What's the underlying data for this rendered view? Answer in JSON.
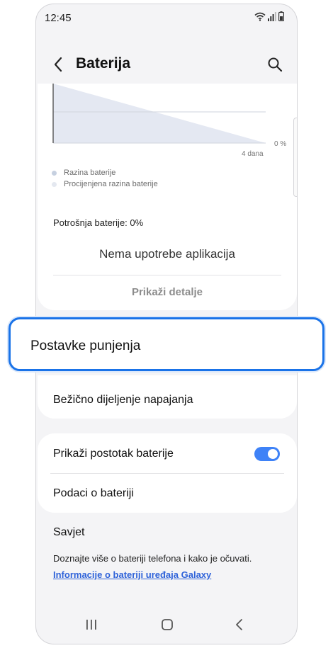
{
  "status_bar": {
    "time": "12:45",
    "icons": [
      "wifi-icon",
      "signal-icon",
      "battery-icon"
    ]
  },
  "header": {
    "title": "Baterija",
    "back_icon": "chevron-left-icon",
    "search_icon": "search-icon"
  },
  "chart_data": {
    "type": "area",
    "x_end_label": "4 dana",
    "y_label": "0 %",
    "series": [
      {
        "name": "Razina baterije",
        "color": "#c6d0e0"
      },
      {
        "name": "Procijenjena razina baterije",
        "color": "#e4e8f0"
      }
    ]
  },
  "usage": {
    "label": "Potrošnja baterije: 0%",
    "no_apps": "Nema upotrebe aplikacija",
    "details_button": "Prikaži detalje"
  },
  "charging": {
    "label": "Postavke punjenja",
    "highlight_color": "#1a73e8"
  },
  "wireless": {
    "label": "Bežično dijeljenje napajanja"
  },
  "settings": {
    "show_percentage": "Prikaži postotak baterije",
    "show_percentage_enabled": true,
    "battery_info": "Podaci o bateriji"
  },
  "tip": {
    "title": "Savjet",
    "text": "Doznajte više o bateriji telefona i kako je očuvati.",
    "link": "Informacije o bateriji uređaja Galaxy"
  },
  "nav": {
    "recent_icon": "recent-apps-icon",
    "home_icon": "home-icon",
    "back_icon": "back-icon"
  },
  "colors": {
    "accent": "#3e82f7",
    "link": "#2e62d9",
    "background": "#f4f4f6"
  }
}
